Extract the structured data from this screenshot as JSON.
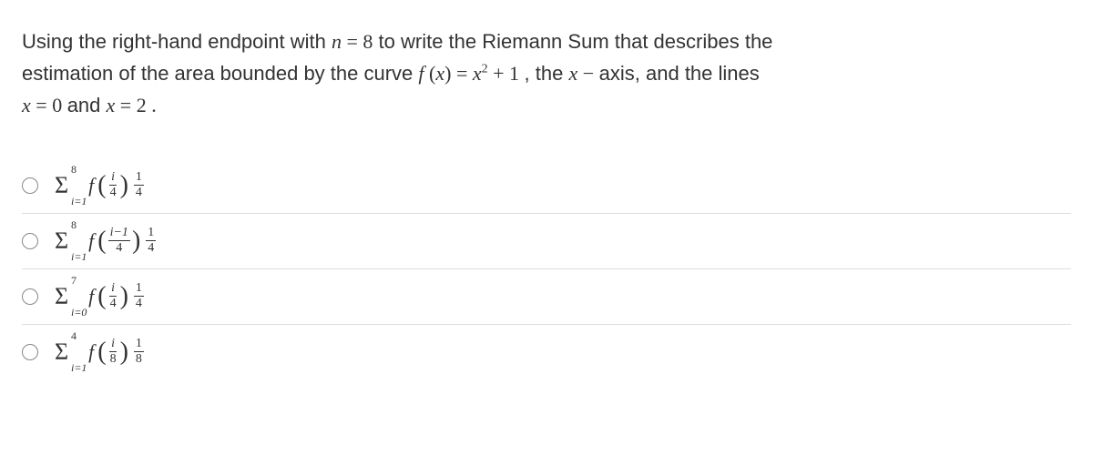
{
  "question": {
    "line1_pre": "Using the right-hand endpoint with ",
    "n_var": "n",
    "eq1": " = ",
    "n_val": "8",
    "line1_post": "  to write the Riemann Sum that describes the",
    "line2_pre": "estimation of the area bounded by the curve ",
    "f_expr_f": "f",
    "f_expr_open": " (",
    "f_expr_x": "x",
    "f_expr_close": ") = ",
    "f_expr_x2": "x",
    "f_expr_sq": "2",
    "f_expr_plus": "  + 1 ",
    "comma_the": ", the ",
    "x_var": "x",
    "dash": " − ",
    "axis_text": "axis, and the lines",
    "line3_x1": "x",
    "line3_eq1": " = ",
    "line3_v1": " 0 ",
    "line3_and": "and ",
    "line3_x2": "x",
    "line3_eq2": " = ",
    "line3_v2": " 2 .",
    "sigma": "Σ",
    "f_label": "f",
    "lparen": "(",
    "rparen": ")"
  },
  "options": [
    {
      "upper": "8",
      "lower": "i=1",
      "arg_num": "i",
      "arg_den": "4",
      "mult_num": "1",
      "mult_den": "4"
    },
    {
      "upper": "8",
      "lower": "i=1",
      "arg_num": "i−1",
      "arg_den": "4",
      "mult_num": "1",
      "mult_den": "4"
    },
    {
      "upper": "7",
      "lower": "i=0",
      "arg_num": "i",
      "arg_den": "4",
      "mult_num": "1",
      "mult_den": "4"
    },
    {
      "upper": "4",
      "lower": "i=1",
      "arg_num": "i",
      "arg_den": "8",
      "mult_num": "1",
      "mult_den": "8"
    }
  ]
}
